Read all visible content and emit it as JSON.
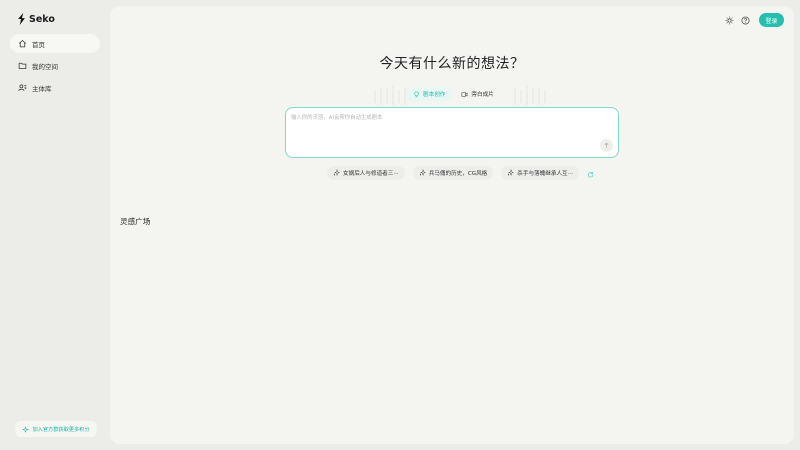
{
  "app": {
    "name": "Seko"
  },
  "sidebar": {
    "items": [
      {
        "label": "首页",
        "icon": "home-icon",
        "active": true
      },
      {
        "label": "我的空间",
        "icon": "folder-icon",
        "active": false
      },
      {
        "label": "主体库",
        "icon": "users-icon",
        "active": false
      }
    ],
    "join_label": "加入官方群获取更多积分"
  },
  "header": {
    "login_label": "登录",
    "icons": [
      "theme-sun-icon",
      "help-icon"
    ]
  },
  "main": {
    "headline": "今天有什么新的想法？",
    "tabs": [
      {
        "label": "剧本创作",
        "icon": "bulb-icon",
        "active": true
      },
      {
        "label": "旁白成片",
        "icon": "film-icon",
        "active": false
      }
    ],
    "prompt": {
      "placeholder": "输入你的灵感，AI会帮你自动生成剧本",
      "value": ""
    },
    "suggestions": [
      "女娲后人与修道者三···",
      "兵马俑的历史，CG风格",
      "杀手与落魄继承人互···"
    ],
    "section_title": "灵感广场"
  },
  "colors": {
    "accent": "#25bfb0",
    "page_bg": "#ecede8",
    "card_bg": "#f4f4f1"
  }
}
